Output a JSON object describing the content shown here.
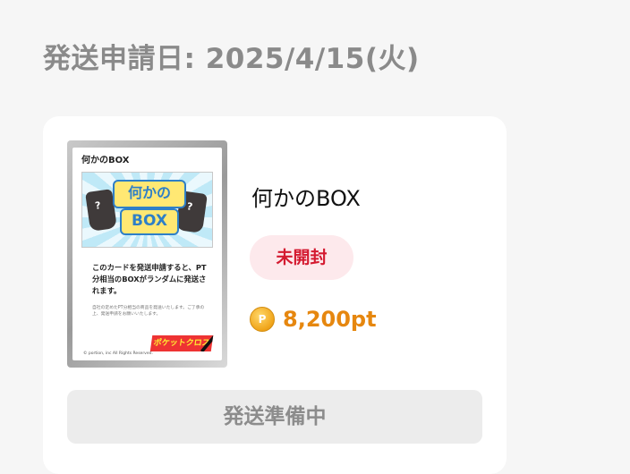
{
  "header": {
    "date_label": "発送申請日: 2025/4/15(火)"
  },
  "card": {
    "image": {
      "title": "何かのBOX",
      "logo_line1": "何かの",
      "logo_line2": "BOX",
      "description": "このカードを発送申請すると、PT分相当のBOXがランダムに発送されます。",
      "fine_print": "自社の定めたPT分相当の商品を発送いたします。ご了承の上、発送申請をお願いいたします。",
      "brand": "ポケットクロス",
      "copyright": "© portion, inc All Rights Reserved."
    },
    "item_name": "何かのBOX",
    "status": "未開封",
    "points": "8,200pt",
    "coin_icon": "P",
    "action_label": "発送準備中"
  },
  "colors": {
    "status_text": "#d41a30",
    "status_bg": "#fde9ec",
    "points": "#e6870f",
    "heading": "#8a8a8a"
  }
}
